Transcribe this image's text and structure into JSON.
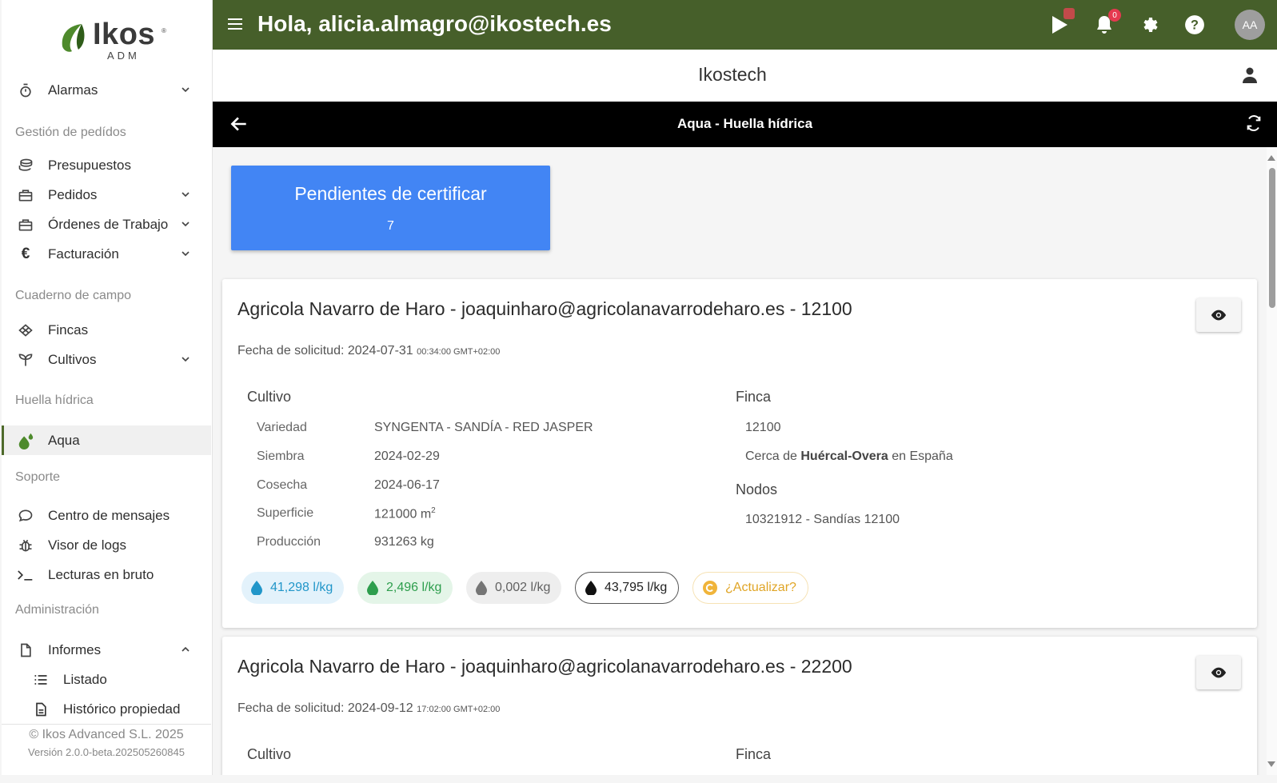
{
  "sidebar": {
    "logo": {
      "word": "Ikos",
      "sub": "ADM",
      "reg": "®"
    },
    "items": [
      {
        "label": "Alarmas"
      },
      {
        "section": "Gestión de pedídos"
      },
      {
        "label": "Presupuestos"
      },
      {
        "label": "Pedidos"
      },
      {
        "label": "Órdenes de Trabajo"
      },
      {
        "label": "Facturación"
      },
      {
        "section": "Cuaderno de campo"
      },
      {
        "label": "Fincas"
      },
      {
        "label": "Cultivos"
      },
      {
        "section": "Huella hídrica"
      },
      {
        "label": "Aqua"
      },
      {
        "section": "Soporte"
      },
      {
        "label": "Centro de mensajes"
      },
      {
        "label": "Visor de logs"
      },
      {
        "label": "Lecturas en bruto"
      },
      {
        "section": "Administración"
      },
      {
        "label": "Informes"
      },
      {
        "label": "Listado"
      },
      {
        "label": "Histórico propiedad"
      }
    ],
    "footer": {
      "copyright": "© Ikos Advanced S.L. 2025",
      "version": "Versión 2.0.0-beta.202505260845"
    }
  },
  "topbar": {
    "greeting": "Hola, alicia.almagro@ikostech.es",
    "notifications_count": "0",
    "avatar_initials": "AA"
  },
  "company": {
    "name": "Ikostech"
  },
  "pagebar": {
    "title": "Aqua - Huella hídrica"
  },
  "pending": {
    "title": "Pendientes de certificar",
    "count": "7"
  },
  "cards": [
    {
      "title": "Agricola Navarro de Haro - joaquinharo@agricolanavarrodeharo.es - 12100",
      "fecha_label": "Fecha de solicitud: 2024-07-31",
      "fecha_time": "00:34:00 GMT+02:00",
      "cultivo_heading": "Cultivo",
      "finca_heading": "Finca",
      "nodos_heading": "Nodos",
      "rows": [
        {
          "label": "Variedad",
          "value": "SYNGENTA - SANDÍA - RED JASPER"
        },
        {
          "label": "Siembra",
          "value": "2024-02-29"
        },
        {
          "label": "Cosecha",
          "value": "2024-06-17"
        },
        {
          "label": "Superficie",
          "value": "121000 m",
          "sup": "2"
        },
        {
          "label": "Producción",
          "value": "931263 kg"
        }
      ],
      "finca_id": "12100",
      "location_pre": "Cerca de ",
      "location_bold": "Huércal-Overa",
      "location_post": " en España",
      "nodo": "10321912 - Sandías 12100",
      "chips": [
        {
          "value": "41,298 l/kg",
          "color": "#2196c9",
          "bg": "#e3f2fb"
        },
        {
          "value": "2,496 l/kg",
          "color": "#2e9e4d",
          "bg": "#e4f5e8"
        },
        {
          "value": "0,002 l/kg",
          "color": "#616161",
          "bg": "#eeeeee"
        },
        {
          "value": "43,795 l/kg",
          "color": "#212121",
          "bg": "#ffffff"
        },
        {
          "value": "¿Actualizar?",
          "color": "#e0a526",
          "bg": "#ffffff"
        }
      ]
    },
    {
      "title": "Agricola Navarro de Haro - joaquinharo@agricolanavarrodeharo.es - 22200",
      "fecha_label": "Fecha de solicitud: 2024-09-12",
      "fecha_time": "17:02:00 GMT+02:00",
      "cultivo_heading": "Cultivo",
      "finca_heading": "Finca"
    }
  ]
}
